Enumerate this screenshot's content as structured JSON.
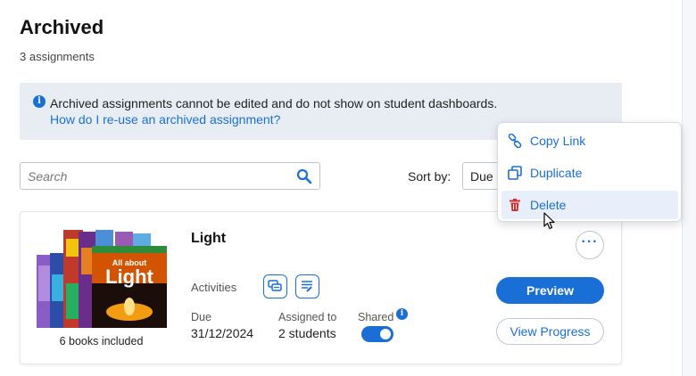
{
  "page": {
    "title": "Archived",
    "count": "3 assignments"
  },
  "info": {
    "icon": "info-icon",
    "text": "Archived assignments cannot be edited and do not show on student dashboards.",
    "link": "How do I re-use an archived assignment?"
  },
  "search": {
    "placeholder": "Search",
    "value": "",
    "icon": "search-icon"
  },
  "sort": {
    "label": "Sort by:",
    "selected": "Due"
  },
  "assignment": {
    "title": "Light",
    "cover_text": "All about Light",
    "books_caption": "6 books included",
    "activities_label": "Activities",
    "activity_icons": [
      "chat-activity-icon",
      "worksheet-activity-icon"
    ],
    "due_label": "Due",
    "due_value": "31/12/2024",
    "assigned_label": "Assigned to",
    "assigned_value": "2 students",
    "shared_label": "Shared",
    "shared": true,
    "preview_label": "Preview",
    "progress_label": "View Progress",
    "more_label": "···"
  },
  "menu": {
    "items": [
      {
        "label": "Copy Link",
        "icon": "link-icon"
      },
      {
        "label": "Duplicate",
        "icon": "duplicate-icon"
      },
      {
        "label": "Delete",
        "icon": "trash-icon",
        "color": "#d32f2f"
      }
    ]
  },
  "colors": {
    "accent": "#1a6fd6",
    "info_bg": "#e8edf4",
    "danger": "#d32f2f"
  }
}
